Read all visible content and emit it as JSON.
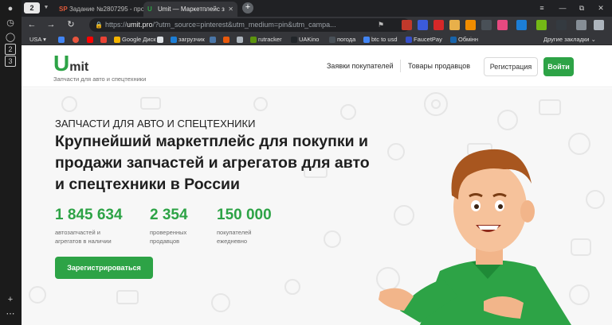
{
  "os": {
    "left_num_1": "2",
    "left_num_2": "3"
  },
  "tabs": [
    {
      "label": "Задание №2807295 - прос",
      "favicon_text": "SP"
    },
    {
      "label": "Umit — Маркетплейс з",
      "favicon_text": "U"
    }
  ],
  "address": {
    "scheme": "https://",
    "host": "umit.pro",
    "path": "/?utm_source=pinterest&utm_medium=pin&utm_campa..."
  },
  "bookmarks": [
    {
      "label": "USA",
      "icon": "dropdown"
    },
    {
      "label": "",
      "icon": "google-icon"
    },
    {
      "label": "",
      "icon": "opera-icon"
    },
    {
      "label": "",
      "icon": "youtube-icon"
    },
    {
      "label": "",
      "icon": "gmail-icon"
    },
    {
      "label": "Google Диск",
      "icon": "drive-icon"
    },
    {
      "label": "",
      "icon": "page-icon"
    },
    {
      "label": "загрузчик",
      "icon": "loader-icon"
    },
    {
      "label": "",
      "icon": "vk-icon"
    },
    {
      "label": "",
      "icon": "red-icon"
    },
    {
      "label": "",
      "icon": "grey-icon"
    },
    {
      "label": "rutracker",
      "icon": "rutracker-icon"
    },
    {
      "label": "UAKino",
      "icon": "uakino-icon"
    },
    {
      "label": "погода",
      "icon": "weather-icon"
    },
    {
      "label": "btc to usd",
      "icon": "google-icon"
    },
    {
      "label": "FaucetPay",
      "icon": "faucetpay-icon"
    },
    {
      "label": "Обмінн",
      "icon": "exchange-icon"
    },
    {
      "label": "Другие закладки",
      "icon": "chevron-icon"
    }
  ],
  "site": {
    "logo_u": "U",
    "logo_mit": "mit",
    "tagline": "Запчасти для авто и спецтехники",
    "nav": [
      "Заявки покупателей",
      "Товары продавцов"
    ],
    "register_label": "Регистрация",
    "login_label": "Войти"
  },
  "hero": {
    "eyebrow": "ЗАПЧАСТИ ДЛЯ АВТО И СПЕЦТЕХНИКИ",
    "headline": "Крупнейший маркетплейс для покупки и продажи запчастей и агрегатов для авто и спецтехники в России",
    "stats": [
      {
        "value": "1 845 634",
        "label": "автозапчастей и агрегатов в наличии"
      },
      {
        "value": "2 354",
        "label": "проверенных продавцов"
      },
      {
        "value": "150 000",
        "label": "покупателей ежедневно"
      }
    ],
    "cta_label": "Зарегистрироваться"
  },
  "colors": {
    "brand": "#2da346",
    "chrome_dark": "#202124",
    "chrome": "#35363a"
  }
}
